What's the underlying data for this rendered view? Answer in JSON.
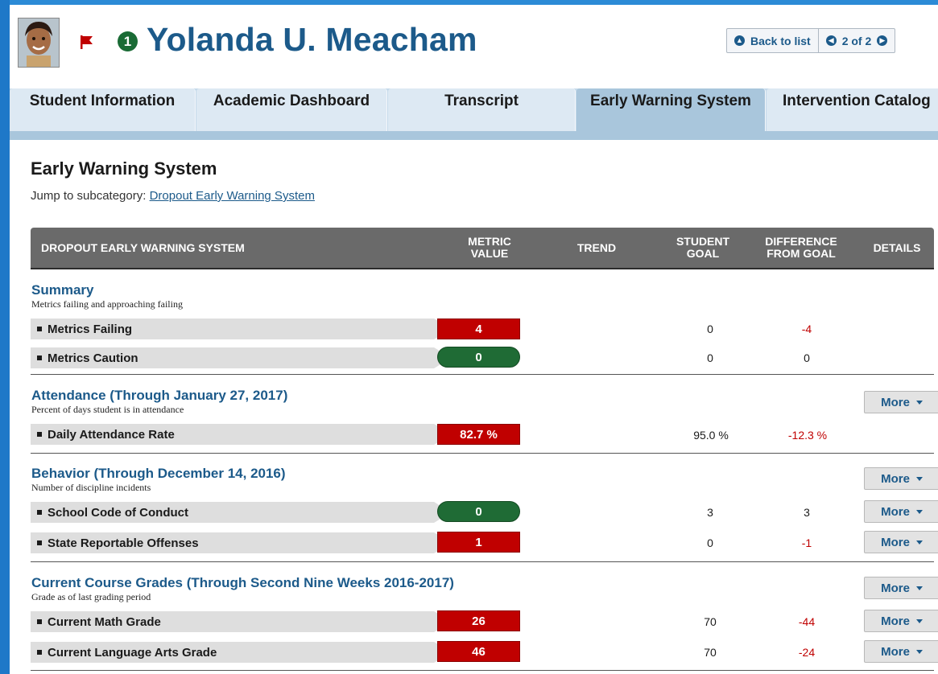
{
  "header": {
    "student_name": "Yolanda U. Meacham",
    "badge_number": "1",
    "back_to_list": "Back to list",
    "pager": "2 of 2"
  },
  "tabs": [
    {
      "label": "Student Information"
    },
    {
      "label": "Academic Dashboard"
    },
    {
      "label": "Transcript"
    },
    {
      "label": "Early Warning System",
      "active": true
    },
    {
      "label": "Intervention Catalog"
    }
  ],
  "page": {
    "title": "Early Warning System",
    "jump_prefix": "Jump to subcategory:",
    "jump_link": "Dropout Early Warning System"
  },
  "table": {
    "headers": {
      "category": "DROPOUT EARLY WARNING SYSTEM",
      "metric_value": "METRIC VALUE",
      "trend": "TREND",
      "student_goal": "STUDENT GOAL",
      "difference": "DIFFERENCE FROM GOAL",
      "details": "DETAILS"
    },
    "more_label": "More",
    "sections": [
      {
        "title": "Summary",
        "subtitle": "Metrics failing and approaching failing",
        "rows": [
          {
            "label": "Metrics Failing",
            "value": "4",
            "status": "fail",
            "goal": "0",
            "diff": "-4"
          },
          {
            "label": "Metrics Caution",
            "value": "0",
            "status": "ok",
            "goal": "0",
            "diff": "0"
          }
        ]
      },
      {
        "title": "Attendance  (Through January 27, 2017)",
        "subtitle": "Percent of days student is in attendance",
        "rows": [
          {
            "label": "Daily Attendance Rate",
            "value": "82.7 %",
            "status": "fail",
            "goal": "95.0 %",
            "diff": "-12.3 %"
          }
        ]
      },
      {
        "title": "Behavior  (Through December 14, 2016)",
        "subtitle": "Number of discipline incidents",
        "rows": [
          {
            "label": "School Code of Conduct",
            "value": "0",
            "status": "ok",
            "goal": "3",
            "diff": "3"
          },
          {
            "label": "State Reportable Offenses",
            "value": "1",
            "status": "fail",
            "goal": "0",
            "diff": "-1"
          }
        ]
      },
      {
        "title": "Current Course Grades  (Through Second Nine Weeks 2016-2017)",
        "subtitle": "Grade as of last grading period",
        "rows": [
          {
            "label": "Current Math Grade",
            "value": "26",
            "status": "fail",
            "goal": "70",
            "diff": "-44"
          },
          {
            "label": "Current Language Arts Grade",
            "value": "46",
            "status": "fail",
            "goal": "70",
            "diff": "-24"
          }
        ]
      }
    ]
  },
  "colors": {
    "accent": "#1c5a8a",
    "fail": "#c00000",
    "ok": "#1f6b35",
    "tab_bar": "#c4d9ea"
  },
  "icons": [
    "student-photo",
    "red-flag-icon",
    "back-arrow-icon",
    "prev-arrow-icon",
    "next-arrow-icon",
    "caret-down-icon"
  ]
}
